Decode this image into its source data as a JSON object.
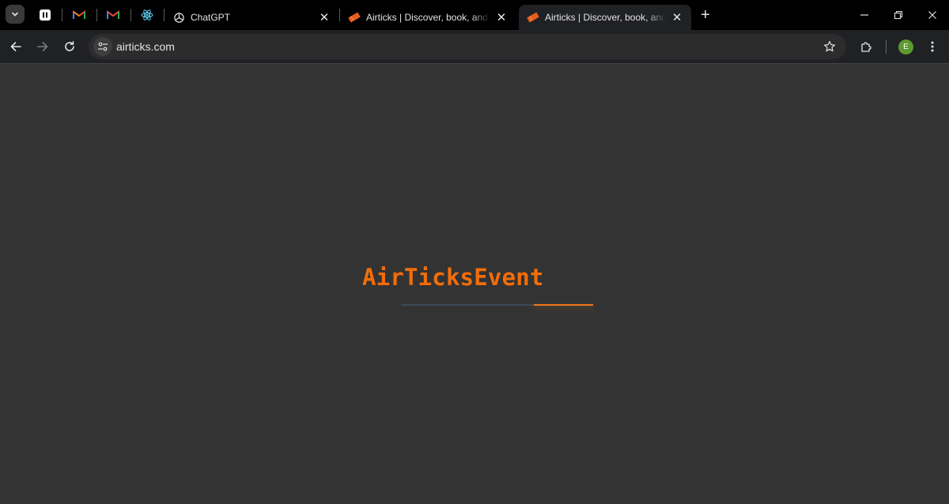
{
  "browser": {
    "tabs": [
      {
        "title": "ChatGPT",
        "close": "✕",
        "active": false
      },
      {
        "title": "Airticks | Discover, book, and attend events",
        "close": "✕",
        "active": false
      },
      {
        "title": "Airticks | Discover, book, and attend events",
        "close": "✕",
        "active": true
      }
    ],
    "new_tab": "+",
    "address": "airticks.com",
    "profile_initial": "E"
  },
  "page": {
    "brand": "AirTicksEvent",
    "loader_progress": 0.31
  },
  "colors": {
    "accent": "#f26d0a",
    "page_background": "#333333",
    "profile": "#5b9a2f"
  },
  "icons": [
    "tab-search-icon",
    "pinned-app-icon",
    "gmail-icon",
    "react-icon",
    "chatgpt-icon",
    "ticket-icon",
    "back-icon",
    "forward-icon",
    "reload-icon",
    "site-info-icon",
    "star-icon",
    "extensions-icon",
    "menu-icon"
  ]
}
